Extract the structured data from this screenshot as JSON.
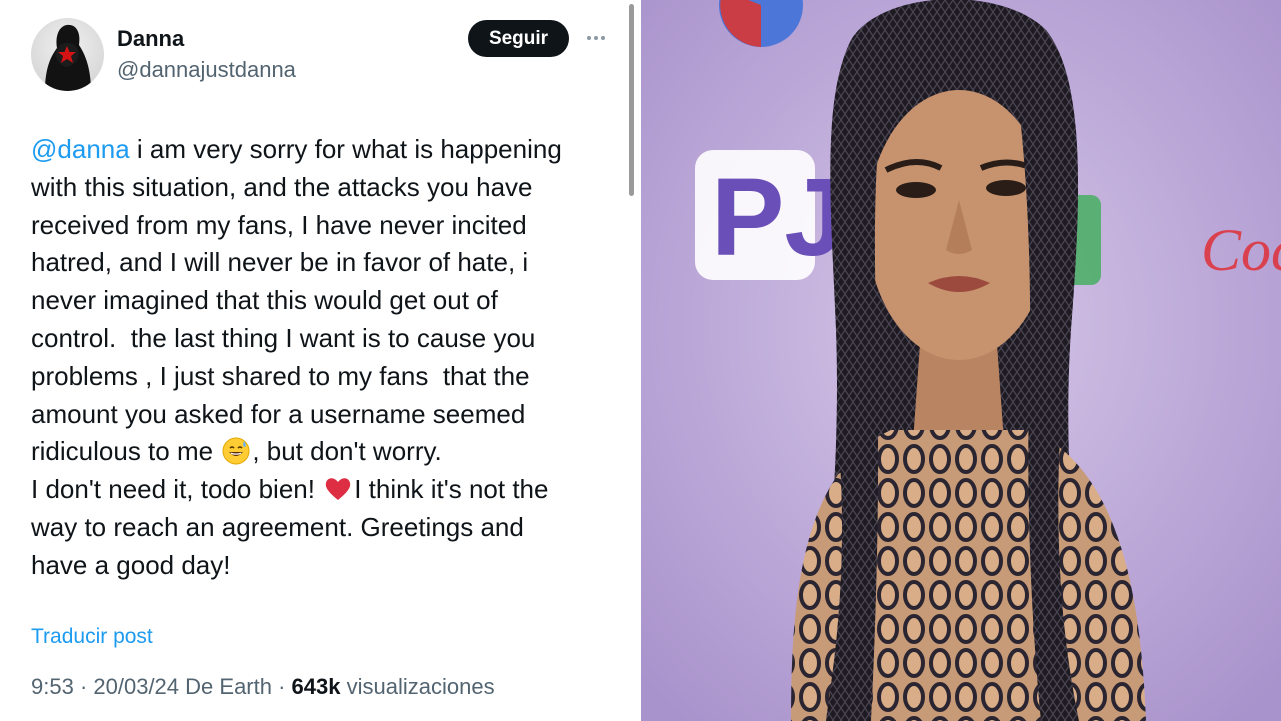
{
  "author": {
    "display_name": "Danna",
    "handle": "@dannajustdanna"
  },
  "actions": {
    "follow_label": "Seguir",
    "more_icon": "more-horizontal-icon"
  },
  "tweet": {
    "lines": [
      {
        "mention": "@danna",
        "text": " i am very sorry for what is happening"
      },
      {
        "text": "with this situation, and the attacks you have"
      },
      {
        "text": "received from my fans, I have never incited"
      },
      {
        "text": "hatred, and I will never be in favor of hate, i"
      },
      {
        "text": "never imagined that this would get out of"
      },
      {
        "text": "control.  the last thing I want is to cause you"
      },
      {
        "text": "problems , I just shared to my fans  that the"
      },
      {
        "text": "amount you asked for a username seemed"
      },
      {
        "before": "ridiculous to me ",
        "emoji": "grinning-sweat-emoji",
        "after": ", but don't worry."
      },
      {
        "before": "I don't need it, todo bien! ",
        "emoji": "red-heart-emoji",
        "after": "I think it's not the"
      },
      {
        "text": "way to reach an agreement. Greetings and"
      },
      {
        "text": "have a good day!"
      }
    ],
    "translate_label": "Traducir post",
    "time": "9:53",
    "date": "20/03/24",
    "location": "De Earth",
    "views_count": "643k",
    "views_label": "visualizaciones"
  },
  "colors": {
    "link": "#1d9bf0",
    "text": "#0f1419",
    "secondary": "#536471",
    "button_bg": "#0f1419"
  },
  "photo": {
    "description_icon": "portrait-photo",
    "backdrop_logo_text": "PJ",
    "backdrop_brand_text": "Coca"
  }
}
